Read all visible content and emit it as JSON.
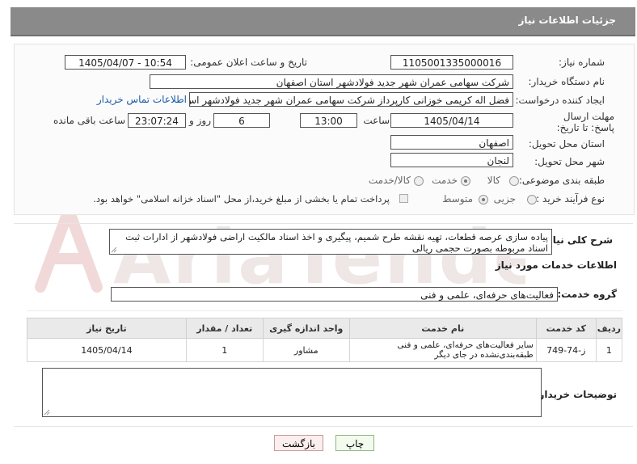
{
  "header": {
    "title": "جزئیات اطلاعات نیاز"
  },
  "watermark": {
    "text": "AriaTender.net"
  },
  "fields": {
    "need_number": {
      "label": "شماره نیاز:",
      "value": "1105001335000016"
    },
    "announce_datetime": {
      "label": "تاریخ و ساعت اعلان عمومی:",
      "value": "1405/04/07 - 10:54"
    },
    "buyer_org": {
      "label": "نام دستگاه خریدار:",
      "value": "شرکت سهامی عمران شهر جدید فولادشهر استان اصفهان"
    },
    "requester": {
      "label": "ایجاد کننده درخواست:",
      "value": "فضل اله کریمی خوزانی کارپرداز شرکت سهامی عمران شهر جدید فولادشهر اس",
      "contact_link": "اطلاعات تماس خریدار"
    },
    "deadline": {
      "label": "مهلت ارسال پاسخ: تا تاریخ:",
      "date": "1405/04/14",
      "time_label": "ساعت",
      "time": "13:00",
      "days": "6",
      "days_label": "روز و",
      "remaining": "23:07:24",
      "remaining_label": "ساعت باقی مانده"
    },
    "province": {
      "label": "استان محل تحویل:",
      "value": "اصفهان"
    },
    "city": {
      "label": "شهر محل تحویل:",
      "value": "لنجان"
    },
    "category": {
      "label": "طبقه بندی موضوعی:",
      "options": [
        "کالا",
        "خدمت",
        "کالا/خدمت"
      ],
      "selected": "خدمت"
    },
    "process_type": {
      "label": "نوع فرآیند خرید :",
      "options": [
        "جزیی",
        "متوسط"
      ],
      "selected": "متوسط",
      "treasury_note": "پرداخت تمام یا بخشی از مبلغ خرید،از محل \"اسناد خزانه اسلامی\" خواهد بود."
    }
  },
  "summary": {
    "label": "شرح کلی نیاز:",
    "text": "پیاده سازی عرصه قطعات، تهیه نقشه طرح شمیم، پیگیری و اخذ اسناد مالکیت اراضی فولادشهر از ادارات ثبت اسناد مربوطه بصورت حجمی ریالی"
  },
  "services_section": {
    "title": "اطلاعات خدمات مورد نیاز",
    "group_label": "گروه خدمت:",
    "group_value": "فعالیت‌های حرفه‌ای، علمی و فنی"
  },
  "table": {
    "headers": [
      "ردیف",
      "کد خدمت",
      "نام خدمت",
      "واحد اندازه گیری",
      "تعداد / مقدار",
      "تاریخ نیاز"
    ],
    "rows": [
      [
        "1",
        "ز-74-749",
        "سایر فعالیت‌های حرفه‌ای، علمی و فنی طبقه‌بندی‌نشده در جای دیگر",
        "مشاور",
        "1",
        "1405/04/14"
      ]
    ]
  },
  "buyer_notes": {
    "label": "توضیحات خریدار:",
    "value": ""
  },
  "buttons": {
    "print": "چاپ",
    "back": "بازگشت"
  }
}
